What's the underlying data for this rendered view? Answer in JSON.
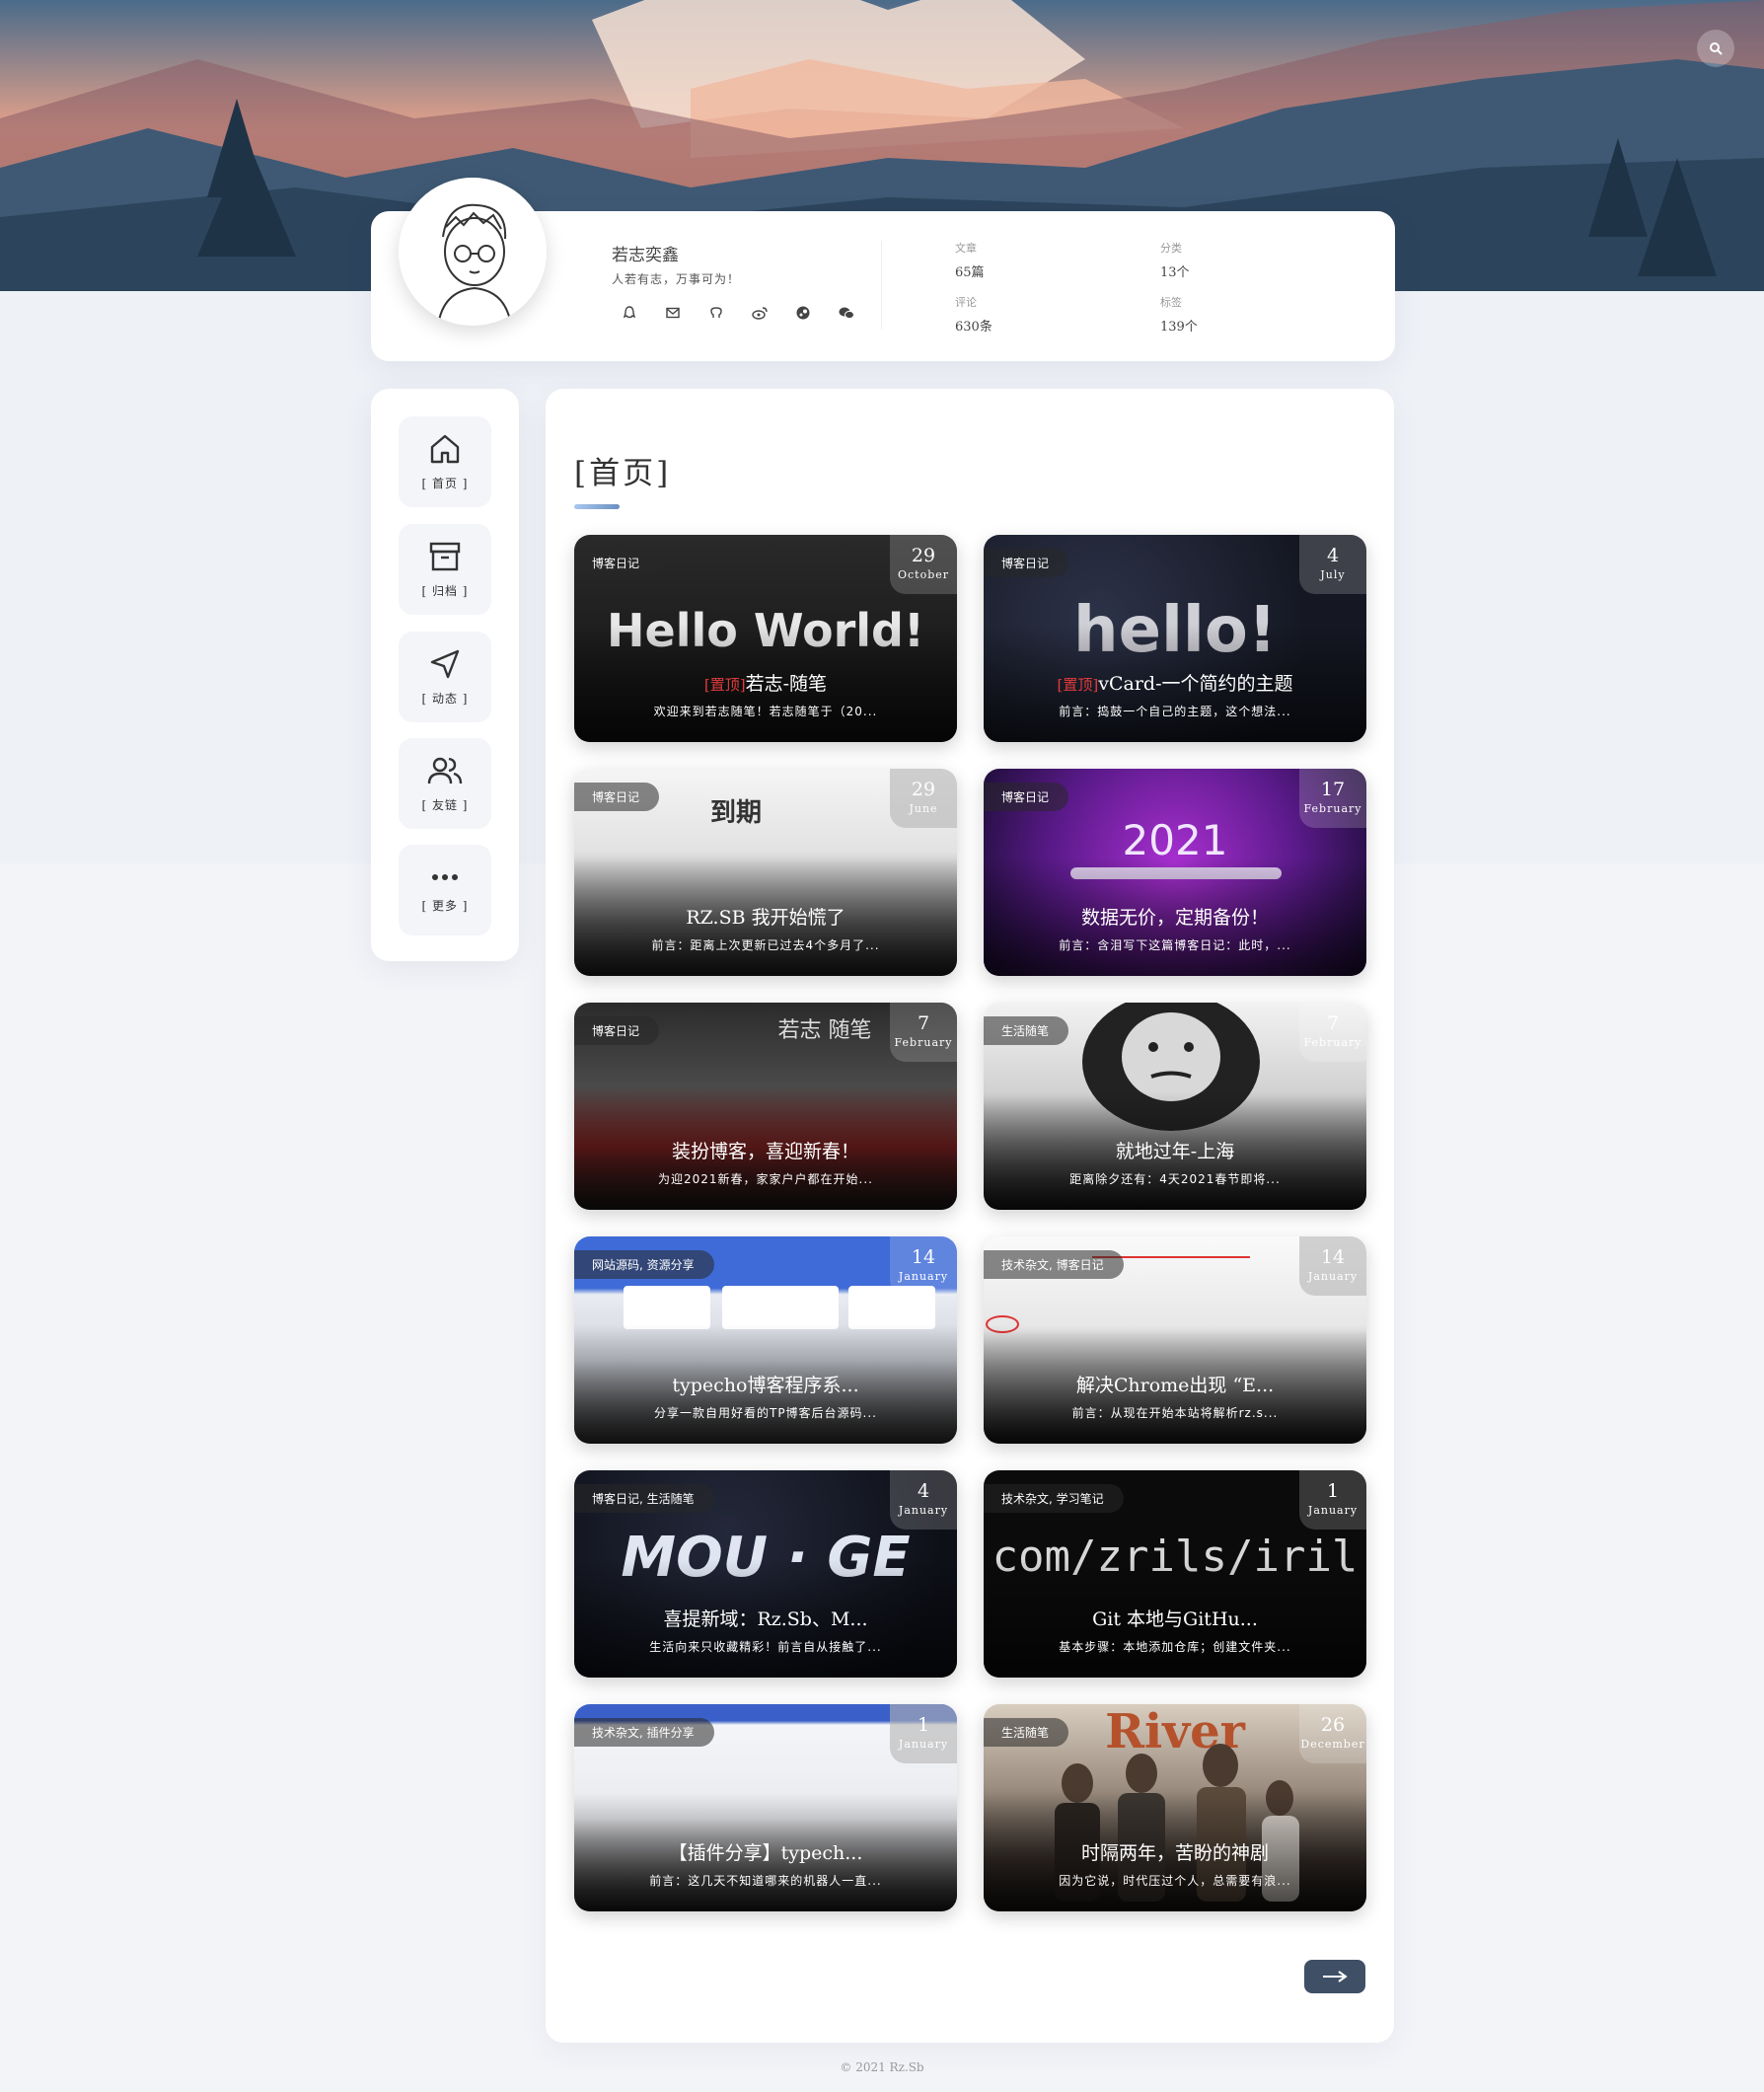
{
  "profile": {
    "name": "若志奕鑫",
    "motto": "人若有志，万事可为！",
    "social_icons": [
      "qq-icon",
      "mail-icon",
      "github-icon",
      "weibo-icon",
      "steam-icon",
      "wechat-icon"
    ],
    "stats": [
      {
        "label": "文章",
        "value": "65篇"
      },
      {
        "label": "分类",
        "value": "13个"
      },
      {
        "label": "评论",
        "value": "630条"
      },
      {
        "label": "标签",
        "value": "139个"
      }
    ]
  },
  "nav": [
    {
      "label": "[ 首页 ]",
      "icon": "home-icon"
    },
    {
      "label": "[ 归档 ]",
      "icon": "archive-icon"
    },
    {
      "label": "[ 动态 ]",
      "icon": "send-icon"
    },
    {
      "label": "[ 友链 ]",
      "icon": "users-icon"
    },
    {
      "label": "[ 更多 ]",
      "icon": "more-icon"
    }
  ],
  "page": {
    "title": "[首页]"
  },
  "cards": [
    {
      "category": "博客日记",
      "day": "29",
      "month": "October",
      "pin": "[置顶]",
      "title": "若志-随笔",
      "excerpt": "欢迎来到若志随笔！若志随笔于（20...",
      "cover_text": "Hello World!"
    },
    {
      "category": "博客日记",
      "day": "4",
      "month": "July",
      "pin": "[置顶]",
      "title": "vCard-一个简约的主题",
      "excerpt": "前言：捣鼓一个自己的主题，这个想法...",
      "cover_text": "hello!"
    },
    {
      "category": "博客日记",
      "day": "29",
      "month": "June",
      "pin": "",
      "title": "RZ.SB 我开始慌了",
      "excerpt": "前言：距离上次更新已过去4个多月了...",
      "cover_text": "到期"
    },
    {
      "category": "博客日记",
      "day": "17",
      "month": "February",
      "pin": "",
      "title": "数据无价，定期备份！",
      "excerpt": "前言：含泪写下这篇博客日记：此时，...",
      "cover_text": "2021"
    },
    {
      "category": "博客日记",
      "day": "7",
      "month": "February",
      "pin": "",
      "title": "装扮博客，喜迎新春！",
      "excerpt": "为迎2021新春，家家户户都在开始...",
      "cover_text": "若志 随笔"
    },
    {
      "category": "生活随笔",
      "day": "7",
      "month": "February",
      "pin": "",
      "title": "就地过年-上海",
      "excerpt": "距离除夕还有：4天2021春节即将...",
      "cover_text": ""
    },
    {
      "category": "网站源码, 资源分享",
      "day": "14",
      "month": "January",
      "pin": "",
      "title": "typecho博客程序系...",
      "excerpt": "分享一款自用好看的TP博客后台源码...",
      "cover_text": ""
    },
    {
      "category": "技术杂文, 博客日记",
      "day": "14",
      "month": "January",
      "pin": "",
      "title": "解决Chrome出现 “E...",
      "excerpt": "前言：从现在开始本站将解析rz.s...",
      "cover_text": ""
    },
    {
      "category": "博客日记, 生活随笔",
      "day": "4",
      "month": "January",
      "pin": "",
      "title": "喜提新域：Rz.Sb、M...",
      "excerpt": "生活向来只收藏精彩！前言自从接触了...",
      "cover_text": "MOU · GE"
    },
    {
      "category": "技术杂文, 学习笔记",
      "day": "1",
      "month": "January",
      "pin": "",
      "title": "Git 本地与GitHu...",
      "excerpt": "基本步骤：本地添加仓库；创建文件夹...",
      "cover_text": "com/zrils/iril"
    },
    {
      "category": "技术杂文, 插件分享",
      "day": "1",
      "month": "January",
      "pin": "",
      "title": "【插件分享】typech...",
      "excerpt": "前言：这几天不知道哪来的机器人一直...",
      "cover_text": ""
    },
    {
      "category": "生活随笔",
      "day": "26",
      "month": "December",
      "pin": "",
      "title": "时隔两年，苦盼的神剧",
      "excerpt": "因为它说，时代压过个人，总需要有浪...",
      "cover_text": "River"
    }
  ],
  "footer": "© 2021 Rz.Sb"
}
